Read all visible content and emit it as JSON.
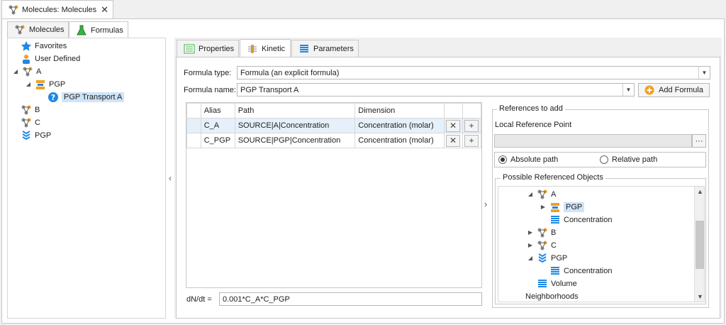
{
  "document_tab": {
    "title": "Molecules: Molecules",
    "close": "✕"
  },
  "left_tabs": [
    {
      "label": "Molecules",
      "icon": "molecule-icon",
      "active": false
    },
    {
      "label": "Formulas",
      "icon": "flask-icon",
      "active": true
    }
  ],
  "tree": {
    "favorites": "Favorites",
    "user_defined": "User Defined",
    "a": "A",
    "pgp_child": "PGP",
    "pgp_transport": "PGP Transport A",
    "b": "B",
    "c": "C",
    "pgp": "PGP"
  },
  "collapse_left": "‹",
  "right_tabs": [
    {
      "label": "Properties",
      "icon": "properties-icon",
      "active": false
    },
    {
      "label": "Kinetic",
      "icon": "kinetic-icon",
      "active": true
    },
    {
      "label": "Parameters",
      "icon": "parameters-icon",
      "active": false
    }
  ],
  "formula": {
    "type_label": "Formula type:",
    "type_value": "Formula (an explicit formula)",
    "name_label": "Formula name:",
    "name_value": "PGP Transport A",
    "add_button": "Add Formula"
  },
  "grid": {
    "headers": [
      "Alias",
      "Path",
      "Dimension"
    ],
    "rows": [
      {
        "alias": "C_A",
        "path": "SOURCE|A|Concentration",
        "dimension": "Concentration (molar)"
      },
      {
        "alias": "C_PGP",
        "path": "SOURCE|PGP|Concentration",
        "dimension": "Concentration (molar)"
      }
    ]
  },
  "expand_arrow": "›",
  "dndt": {
    "label": "dN/dt =",
    "value": "0.001*C_A*C_PGP"
  },
  "references": {
    "group_title": "References to add",
    "local_ref_label": "Local Reference Point",
    "browse": "···",
    "absolute": "Absolute path",
    "relative": "Relative path",
    "absolute_selected": true,
    "possible_title": "Possible Referenced Objects",
    "items": {
      "a": "A",
      "pgp": "PGP",
      "a_conc": "Concentration",
      "b": "B",
      "c": "C",
      "pgp2": "PGP",
      "pgp_conc": "Concentration",
      "volume": "Volume",
      "neighborhoods": "Neighborhoods"
    }
  },
  "colors": {
    "selection": "#cfe4f7",
    "row_highlight": "#e6f0fa",
    "accent_orange": "#f0a020",
    "accent_blue": "#1e88e5"
  }
}
